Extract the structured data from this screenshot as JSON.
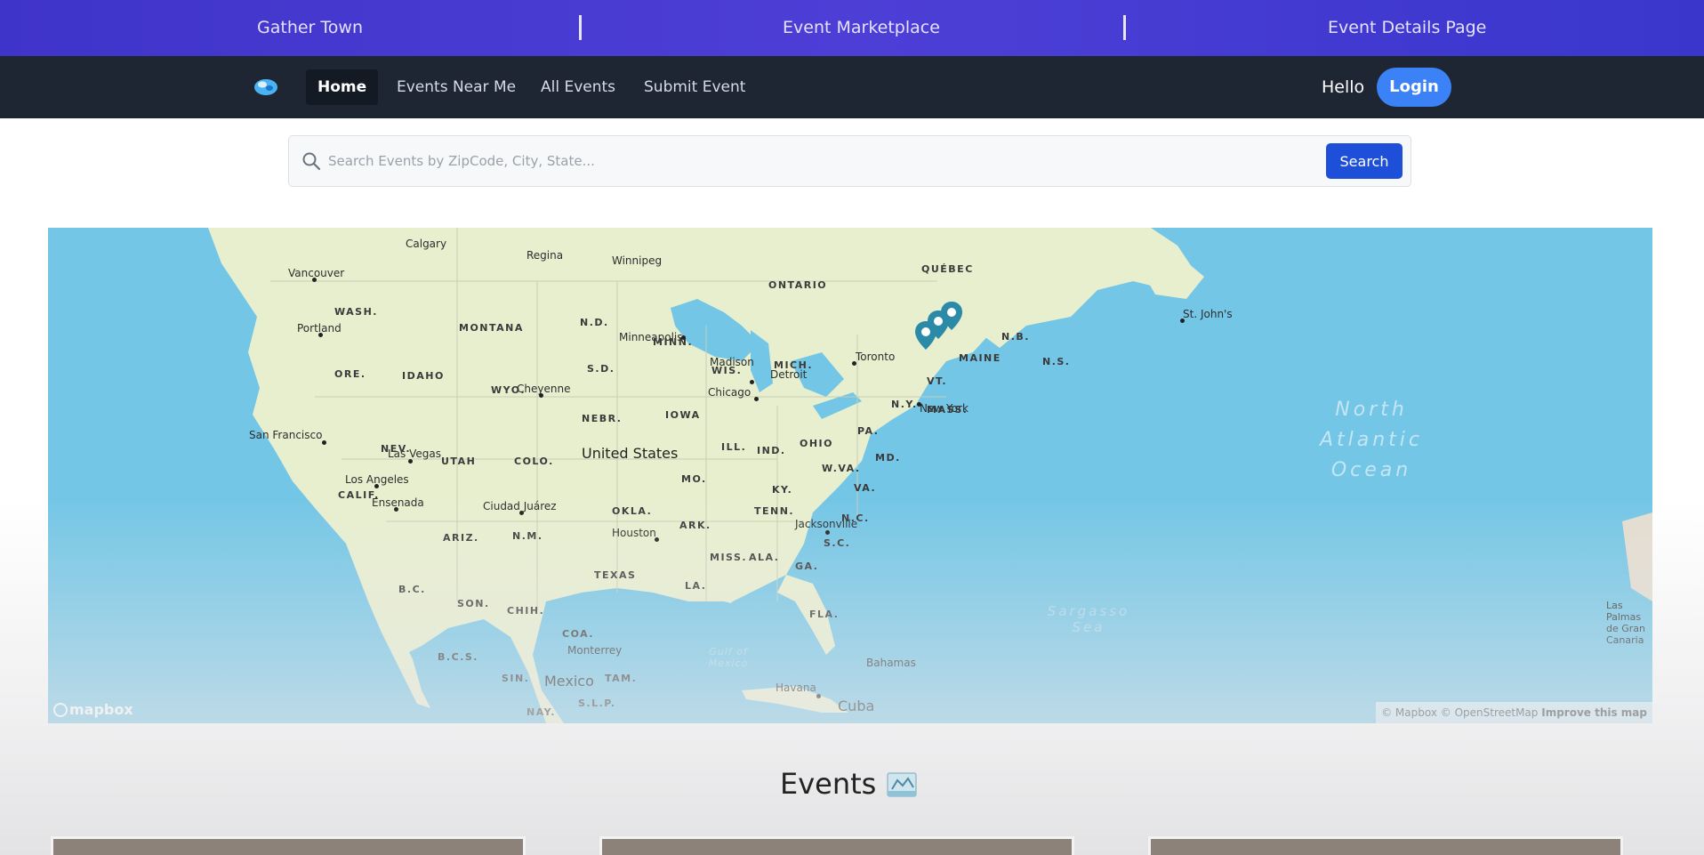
{
  "banner": {
    "items": [
      "Gather Town",
      "Event Marketplace",
      "Event Details Page"
    ]
  },
  "nav": {
    "items": [
      {
        "label": "Home",
        "active": true
      },
      {
        "label": "Events Near Me",
        "active": false
      },
      {
        "label": "All Events",
        "active": false
      },
      {
        "label": "Submit Event",
        "active": false
      }
    ],
    "greeting": "Hello",
    "login_label": "Login"
  },
  "search": {
    "placeholder": "Search Events by ZipCode, City, State...",
    "value": "",
    "button_label": "Search"
  },
  "map": {
    "labels": {
      "countries": [
        "United States",
        "Mexico",
        "Cuba"
      ],
      "states_provinces": [
        "WASH.",
        "MONTANA",
        "N.D.",
        "MINN.",
        "ONTARIO",
        "QUÉBEC",
        "ORE.",
        "IDAHO",
        "WYO.",
        "S.D.",
        "WIS.",
        "MICH.",
        "NEBR.",
        "IOWA",
        "NEV.",
        "UTAH",
        "COLO.",
        "ILL.",
        "IND.",
        "OHIO",
        "PA.",
        "N.Y.",
        "VT.",
        "MAINE",
        "N.B.",
        "N.S.",
        "MASS.",
        "MD.",
        "W.VA.",
        "VA.",
        "KY.",
        "MO.",
        "CALIF.",
        "OKLA.",
        "ARK.",
        "TENN.",
        "N.C.",
        "S.C.",
        "ARIZ.",
        "N.M.",
        "TEXAS",
        "MISS.",
        "ALA.",
        "GA.",
        "LA.",
        "FLA.",
        "SON.",
        "CHIH.",
        "COA.",
        "B.C.",
        "B.C.S.",
        "SIN.",
        "TAM.",
        "S.L.P.",
        "NAY."
      ],
      "cities": [
        "Calgary",
        "Regina",
        "Winnipeg",
        "Vancouver",
        "Portland",
        "Minneapolis",
        "Madison",
        "Toronto",
        "Detroit",
        "Chicago",
        "Cheyenne",
        "San Francisco",
        "Las Vegas",
        "Los Angeles",
        "Ensenada",
        "Ciudad Juárez",
        "Houston",
        "New York",
        "Jacksonville",
        "Monterrey",
        "Havana",
        "Bahamas",
        "St. John's",
        "Las Palmas de Gran Canaria"
      ],
      "oceans": [
        "North Atlantic Ocean",
        "Sargasso Sea",
        "Gulf of Mexico"
      ]
    },
    "markers_count": 3,
    "logo_text": "mapbox",
    "attribution": "© Mapbox © OpenStreetMap",
    "improve_label": "Improve this map"
  },
  "events": {
    "title": "Events",
    "icon": "map-icon"
  },
  "colors": {
    "banner": "#4339cf",
    "nav": "#1f2633",
    "login": "#3b82f6",
    "search_button": "#1e4fd9",
    "water": "#74c6e6",
    "land": "#e8efcf",
    "marker": "#2a8aa8"
  }
}
